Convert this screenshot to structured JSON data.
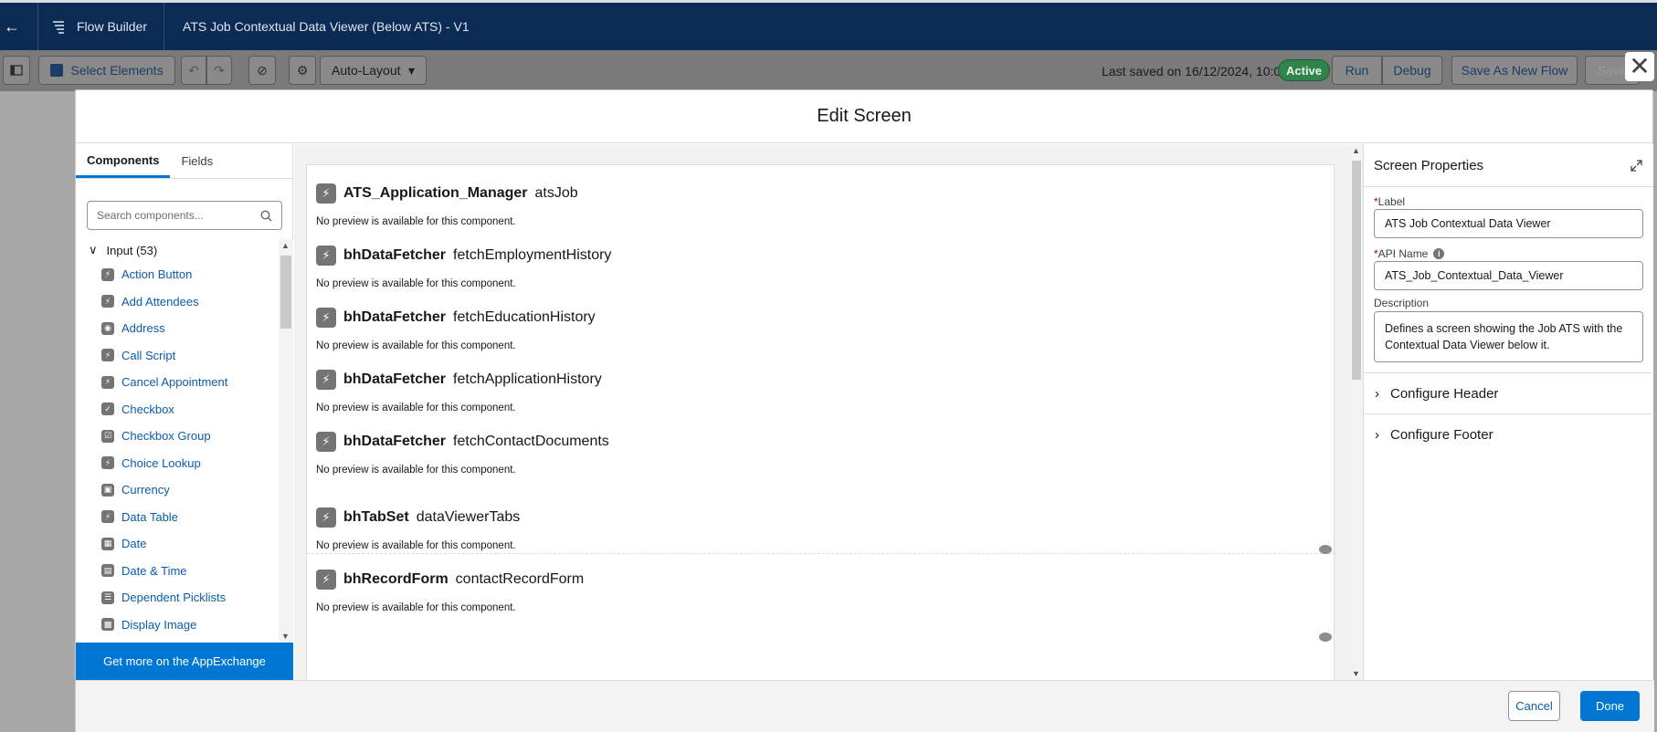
{
  "header": {
    "app_title": "Flow Builder",
    "flow_name": "ATS Job Contextual Data Viewer (Below ATS) - V1"
  },
  "toolbar": {
    "select_elements": "Select Elements",
    "layout_mode": "Auto-Layout",
    "last_saved": "Last saved on 16/12/2024, 10:01",
    "status": "Active",
    "run": "Run",
    "debug": "Debug",
    "save_as_new": "Save As New Flow",
    "save": "Save"
  },
  "modal": {
    "title": "Edit Screen",
    "close_icon": "close-icon"
  },
  "palette": {
    "tabs": [
      "Components",
      "Fields"
    ],
    "search_placeholder": "Search components...",
    "group_label": "Input (53)",
    "items": [
      {
        "label": "Action Button",
        "icon": "bolt-icon"
      },
      {
        "label": "Add Attendees",
        "icon": "bolt-icon"
      },
      {
        "label": "Address",
        "icon": "location-icon"
      },
      {
        "label": "Call Script",
        "icon": "bolt-icon"
      },
      {
        "label": "Cancel Appointment",
        "icon": "bolt-icon"
      },
      {
        "label": "Checkbox",
        "icon": "checkbox-icon"
      },
      {
        "label": "Checkbox Group",
        "icon": "checkbox-group-icon"
      },
      {
        "label": "Choice Lookup",
        "icon": "bolt-icon"
      },
      {
        "label": "Currency",
        "icon": "currency-icon"
      },
      {
        "label": "Data Table",
        "icon": "bolt-icon"
      },
      {
        "label": "Date",
        "icon": "date-icon"
      },
      {
        "label": "Date & Time",
        "icon": "datetime-icon"
      },
      {
        "label": "Dependent Picklists",
        "icon": "picklist-icon"
      },
      {
        "label": "Display Image",
        "icon": "image-icon"
      }
    ],
    "appexchange": "Get more on the AppExchange"
  },
  "canvas": {
    "components": [
      {
        "name": "ATS_Application_Manager",
        "api": "atsJob",
        "note": "No preview is available for this component."
      },
      {
        "name": "bhDataFetcher",
        "api": "fetchEmploymentHistory",
        "note": "No preview is available for this component."
      },
      {
        "name": "bhDataFetcher",
        "api": "fetchEducationHistory",
        "note": "No preview is available for this component."
      },
      {
        "name": "bhDataFetcher",
        "api": "fetchApplicationHistory",
        "note": "No preview is available for this component."
      },
      {
        "name": "bhDataFetcher",
        "api": "fetchContactDocuments",
        "note": "No preview is available for this component."
      },
      {
        "name": "bhTabSet",
        "api": "dataViewerTabs",
        "note": "No preview is available for this component."
      },
      {
        "name": "bhRecordForm",
        "api": "contactRecordForm",
        "note": "No preview is available for this component."
      }
    ]
  },
  "properties": {
    "title": "Screen Properties",
    "label_label": "Label",
    "label_value": "ATS Job Contextual Data Viewer",
    "api_label": "API Name",
    "api_value": "ATS_Job_Contextual_Data_Viewer",
    "description_label": "Description",
    "description_value": "Defines a screen showing the Job ATS with the Contextual Data Viewer below it.",
    "sections": [
      "Configure Header",
      "Configure Footer"
    ]
  },
  "footer": {
    "cancel": "Cancel",
    "done": "Done"
  },
  "colors": {
    "header_bg": "#0b2b55",
    "brand_blue": "#0176d3",
    "active_green": "#2e844a"
  }
}
